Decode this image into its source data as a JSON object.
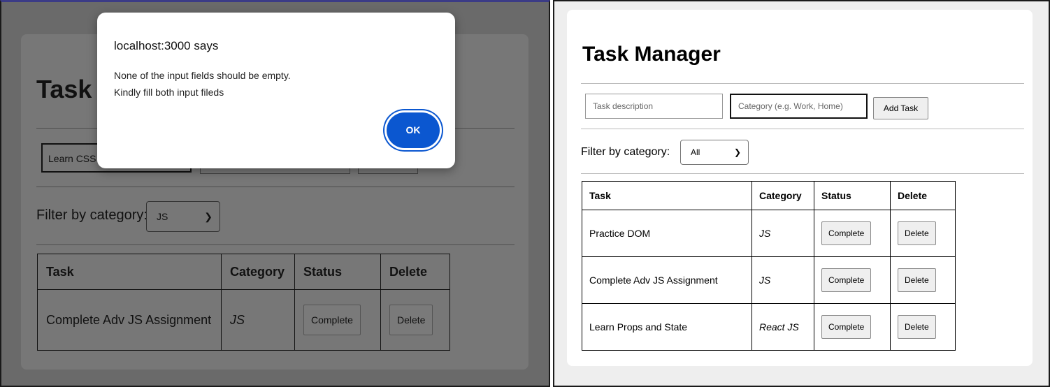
{
  "left": {
    "title": "Task",
    "inputs": {
      "task_value": "Learn CSS",
      "category_value": "",
      "add_label": ""
    },
    "filter": {
      "label": "Filter by category:",
      "selected": "JS"
    },
    "table": {
      "headers": [
        "Task",
        "Category",
        "Status",
        "Delete"
      ],
      "rows": [
        {
          "task": "Complete Adv JS Assignment",
          "category": "JS",
          "status": "Complete",
          "delete": "Delete"
        }
      ]
    }
  },
  "dialog": {
    "title": "localhost:3000 says",
    "line1": "None of the input fields should be empty.",
    "line2": "Kindly fill both input fileds",
    "ok": "OK"
  },
  "right": {
    "title": "Task Manager",
    "inputs": {
      "task_placeholder": "Task description",
      "category_placeholder": "Category (e.g. Work, Home)",
      "add_label": "Add Task"
    },
    "filter": {
      "label": "Filter by category:",
      "selected": "All"
    },
    "table": {
      "headers": [
        "Task",
        "Category",
        "Status",
        "Delete"
      ],
      "rows": [
        {
          "task": "Practice DOM",
          "category": "JS",
          "status": "Complete",
          "delete": "Delete"
        },
        {
          "task": "Complete Adv JS Assignment",
          "category": "JS",
          "status": "Complete",
          "delete": "Delete"
        },
        {
          "task": "Learn Props and State",
          "category": "React JS",
          "status": "Complete",
          "delete": "Delete"
        }
      ]
    }
  },
  "colors": {
    "dialog_ok": "#0b57d0",
    "overlay": "#6a6a6a"
  },
  "icons": {
    "select_chevron": "chevron-down-icon"
  }
}
